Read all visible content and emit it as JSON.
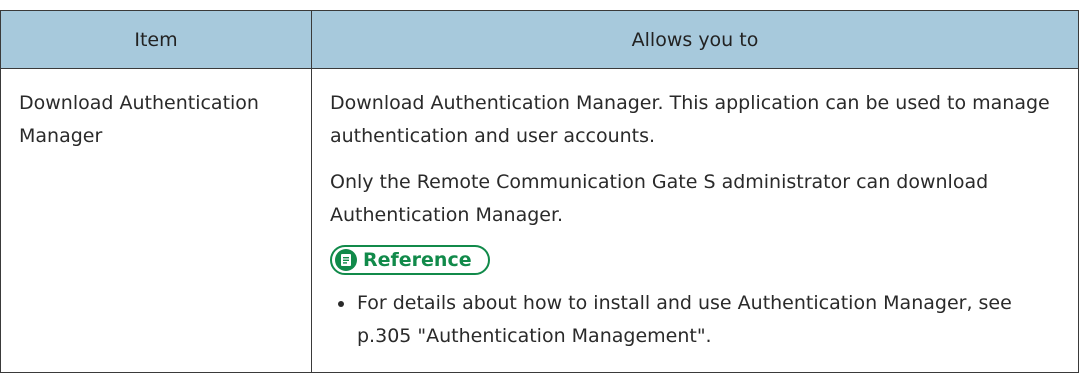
{
  "table": {
    "headers": {
      "item": "Item",
      "allows": "Allows you to"
    },
    "rows": [
      {
        "item": "Download Authentication Manager",
        "paragraphs": [
          "Download Authentication Manager. This application can be used to manage authentication and user accounts.",
          "Only the Remote Communication Gate S administrator can download Authentication Manager."
        ],
        "reference": {
          "label": "Reference",
          "icon": "reference-note-icon",
          "bullets": [
            "For details about how to install and use Authentication Manager, see p.305 \"Authentication Management\"."
          ]
        }
      }
    ]
  },
  "colors": {
    "header_background": "#a7c9dc",
    "reference_accent": "#118a4a",
    "border": "#3a3a3a"
  }
}
